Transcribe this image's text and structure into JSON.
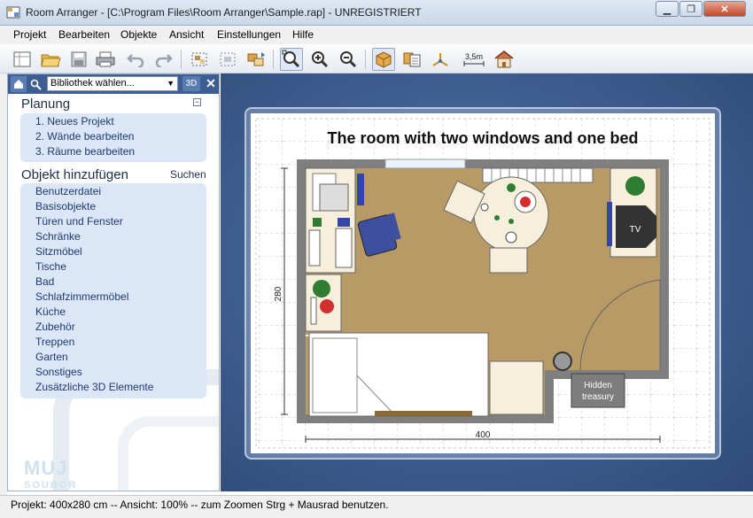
{
  "window": {
    "title": "Room Arranger - [C:\\Program Files\\Room Arranger\\Sample.rap] - UNREGISTRIERT",
    "minimize": "▁",
    "maximize": "❐",
    "close": "✕"
  },
  "menu": [
    "Projekt",
    "Bearbeiten",
    "Objekte",
    "Ansicht",
    "Einstellungen",
    "Hilfe"
  ],
  "toolbar": {
    "icons": [
      "new-project-icon",
      "open-folder-icon",
      "save-icon",
      "print-icon",
      "undo-icon",
      "redo-icon",
      "select-all-icon",
      "select-area-icon",
      "move-objects-icon",
      "zoom-fit-icon",
      "zoom-in-icon",
      "zoom-out-icon",
      "box-3d-icon",
      "copy-objects-icon",
      "axes-icon",
      "measure-icon",
      "house-3d-icon"
    ],
    "measure_label": "3,5m"
  },
  "sidebar": {
    "library_select": "Bibliothek wählen...",
    "btn_3d": "3D",
    "close": "✕",
    "planning_title": "Planung",
    "collapse": "−",
    "planning_items": [
      "1. Neues Projekt",
      "2. Wände bearbeiten",
      "3. Räume bearbeiten"
    ],
    "add_object_title": "Objekt hinzufügen",
    "search_label": "Suchen",
    "categories": [
      "Benutzerdatei",
      "Basisobjekte",
      "Türen und Fenster",
      "Schränke",
      "Sitzmöbel",
      "Tische",
      "Bad",
      "Schlafzimmermöbel",
      "Küche",
      "Zubehör",
      "Treppen",
      "Garten",
      "Sonstiges",
      "Zusätzliche 3D Elemente"
    ],
    "watermark": "MUJ",
    "watermark2": "SOUBOR"
  },
  "plan": {
    "title": "The room with two windows and one bed",
    "dim_height": "280",
    "dim_width": "400",
    "tv_label": "TV",
    "treasury_label_1": "Hidden",
    "treasury_label_2": "treasury"
  },
  "status": {
    "text": "Projekt: 400x280 cm -- Ansicht: 100% -- zum Zoomen Strg + Mausrad benutzen."
  },
  "colors": {
    "accent": "#3e5e93",
    "floor": "#b89a66",
    "wall": "#7f7f7f",
    "panel": "#dbe6f6"
  }
}
